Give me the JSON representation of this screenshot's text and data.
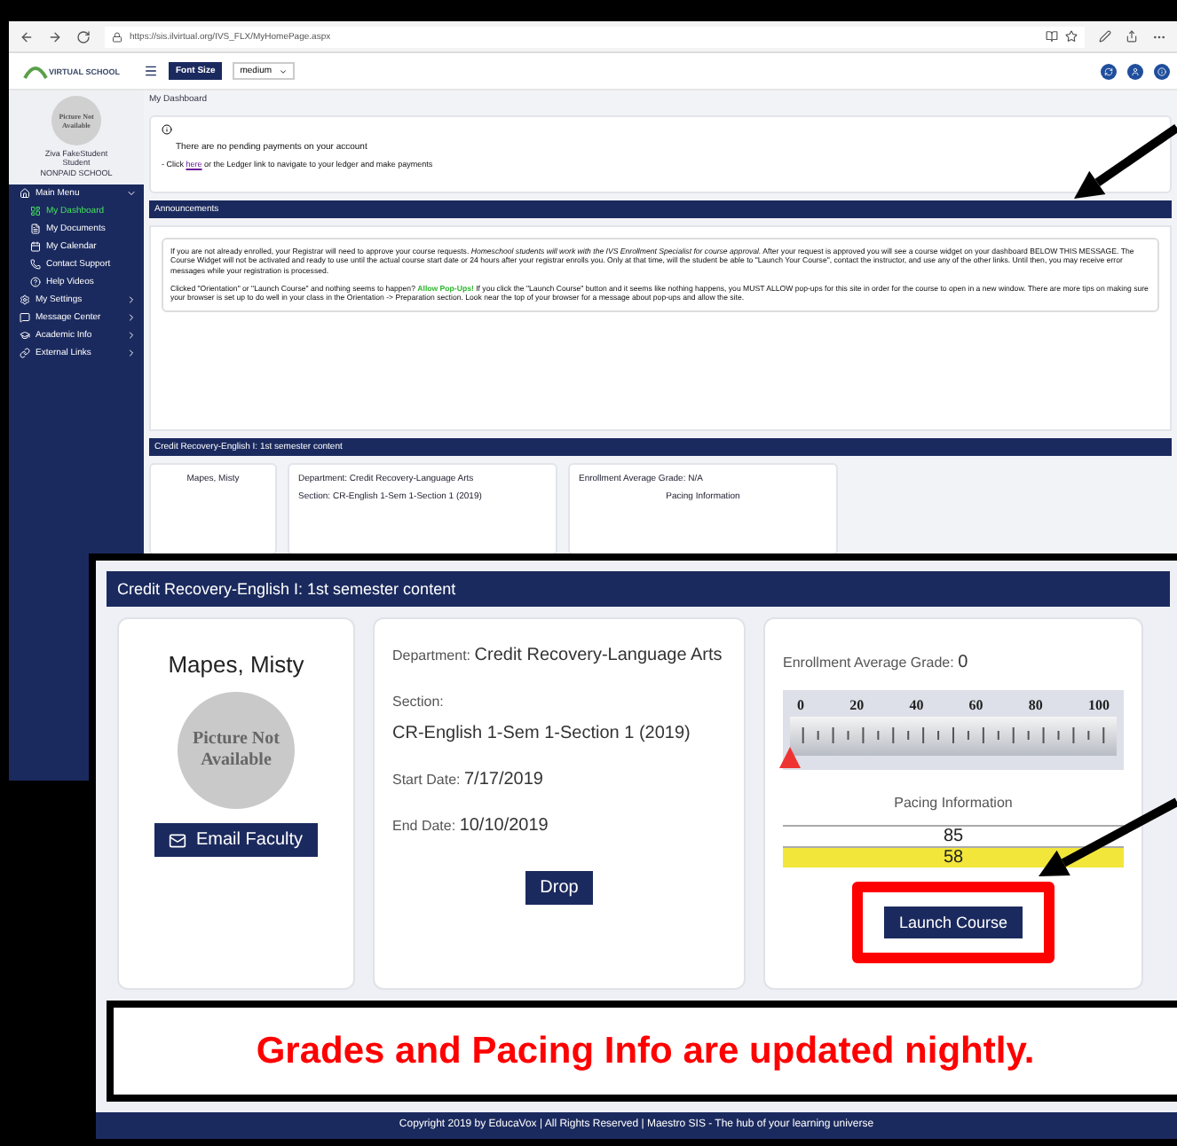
{
  "browser": {
    "url": "https://sis.ilvirtual.org/IVS_FLX/MyHomePage.aspx"
  },
  "app_header": {
    "logo_text": "VIRTUAL SCHOOL",
    "font_size_label": "Font Size",
    "font_size_value": "medium"
  },
  "profile": {
    "photo_text": "Picture Not Available",
    "name": "Ziva FakeStudent",
    "role": "Student",
    "school": "NONPAID SCHOOL"
  },
  "sidebar": {
    "items": [
      {
        "label": "Main Menu",
        "expanded": true,
        "children": [
          {
            "label": "My Dashboard",
            "selected": true
          },
          {
            "label": "My Documents",
            "selected": false
          },
          {
            "label": "My Calendar",
            "selected": false
          },
          {
            "label": "Contact Support",
            "selected": false
          },
          {
            "label": "Help Videos",
            "selected": false
          }
        ]
      },
      {
        "label": "My Settings",
        "expanded": false
      },
      {
        "label": "Message Center",
        "expanded": false
      },
      {
        "label": "Academic Info",
        "expanded": false
      },
      {
        "label": "External Links",
        "expanded": false
      }
    ]
  },
  "breadcrumb": "My Dashboard",
  "payment_notice": {
    "message": "There are no pending payments on your account",
    "before_link": "- Click ",
    "link": "here",
    "after_link": " or the Ledger link to navigate to your ledger and make payments"
  },
  "announcements": {
    "title": "Announcements",
    "paragraphs": [
      [
        {
          "kind": "text",
          "text": "If you are not already enrolled, your Registrar will need to approve your course requests.  *Homeschool students will work with the IVS Enrollment Specialist for course approval.* After your request is approved you will see a course widget on your dashboard BELOW THIS MESSAGE. The Course Widget will not be activated and ready to use until the actual course start date or 24 hours after your registrar enrolls you.  Only at that time, will the student be able to \"Launch Your Course\", contact the instructor, and use any of the other links.  Until then, you may receive error messages while your registration is processed."
        }
      ],
      [
        {
          "kind": "text",
          "text": "Clicked \"Orientation\" or \"Launch Course\" and nothing seems to happen? "
        },
        {
          "kind": "highlight",
          "text": "Allow Pop-Ups!"
        },
        {
          "kind": "text",
          "text": " If you click the \"Launch Course\" button and it seems like nothing happens, you MUST ALLOW pop-ups for this site in order for the course to open in a new window.  There are more tips on making sure your browser is set up to do well in your class in the Orientation -> Preparation section. Look near the top of your browser for a message about pop-ups and allow the site."
        }
      ]
    ]
  },
  "background_course": {
    "title": "Credit Recovery-English I: 1st semester content",
    "instructor": "Mapes, Misty",
    "details": [
      {
        "label": "Department:",
        "value": "Credit Recovery-Language Arts"
      },
      {
        "label": "Section:",
        "value": "CR-English 1-Sem 1-Section 1 (2019)"
      }
    ],
    "grade_label": "Enrollment Average Grade:",
    "grade_value": "N/A",
    "pacing_title": "Pacing Information"
  },
  "callout": {
    "course_title": "Credit Recovery-English I: 1st semester content",
    "instructor": {
      "name": "Mapes, Misty",
      "photo_text": "Picture Not Available",
      "email_button": "Email Faculty"
    },
    "details": [
      {
        "label": "Department:",
        "value": "Credit Recovery-Language Arts"
      },
      {
        "label": "Section:",
        "value": "CR-English 1-Sem 1-Section 1 (2019)"
      },
      {
        "label": "Start Date:",
        "value": "7/17/2019"
      },
      {
        "label": "End Date:",
        "value": "10/10/2019"
      }
    ],
    "drop_button": "Drop",
    "grade": {
      "label": "Enrollment Average Grade:",
      "value": "0",
      "level": 0,
      "ticks": [
        "0",
        "20",
        "40",
        "60",
        "80",
        "100"
      ]
    },
    "pacing": {
      "title": "Pacing Information",
      "rows": [
        {
          "value": "85",
          "color": "#ffffff"
        },
        {
          "value": "58",
          "color": "#f2e63a"
        }
      ]
    },
    "launch_button": "Launch Course"
  },
  "caption": "Grades and Pacing Info are updated nightly.",
  "footer": "Copyright 2019 by EducaVox | All Rights Reserved | Maestro SIS - The hub of your learning universe"
}
